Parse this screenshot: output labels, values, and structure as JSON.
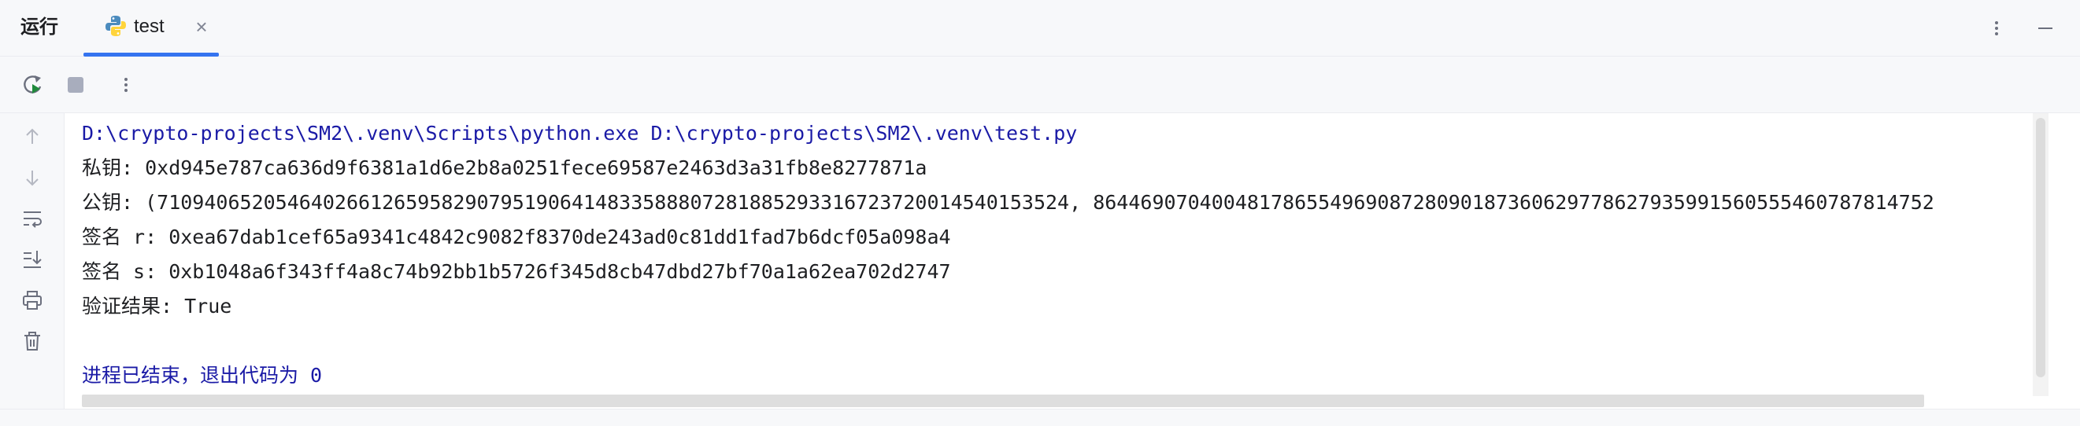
{
  "header": {
    "panel_title": "运行",
    "tab_label": "test",
    "tab_icon": "python-icon",
    "accent_color": "#3574f0"
  },
  "console": {
    "lines": [
      "D:\\crypto-projects\\SM2\\.venv\\Scripts\\python.exe D:\\crypto-projects\\SM2\\.venv\\test.py",
      "私钥: 0xd945e787ca636d9f6381a1d6e2b8a0251fece69587e2463d3a31fb8e8277871a",
      "公钥: (71094065205464026612659582907951906414833588807281885293316723720014540153524, 86446907040048178655496908728090187360629778627935991560555460787814752",
      "签名 r: 0xea67dab1cef65a9341c4842c9082f8370de243ad0c81dd1fad7b6dcf05a098a4",
      "签名 s: 0xb1048a6f343ff4a8c74b92bb1b5726f345d8cb47dbd27bf70a1a62ea702d2747",
      "验证结果: True",
      "",
      "进程已结束，退出代码为 0"
    ]
  }
}
